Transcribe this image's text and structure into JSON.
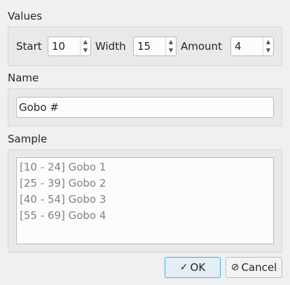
{
  "values": {
    "label": "Values",
    "start": {
      "label": "Start",
      "value": "10"
    },
    "width": {
      "label": "Width",
      "value": "15"
    },
    "amount": {
      "label": "Amount",
      "value": "4"
    }
  },
  "name": {
    "label": "Name",
    "value": "Gobo #"
  },
  "sample": {
    "label": "Sample",
    "items": [
      "[10 - 24] Gobo 1",
      "[25 - 39] Gobo 2",
      "[40 - 54] Gobo 3",
      "[55 - 69] Gobo 4"
    ]
  },
  "buttons": {
    "ok": "OK",
    "cancel": "Cancel"
  },
  "icons": {
    "ok": "checkmark-icon",
    "cancel": "cancel-icon"
  },
  "colors": {
    "accent": "#3daee9",
    "window_bg": "#eff0f1"
  }
}
